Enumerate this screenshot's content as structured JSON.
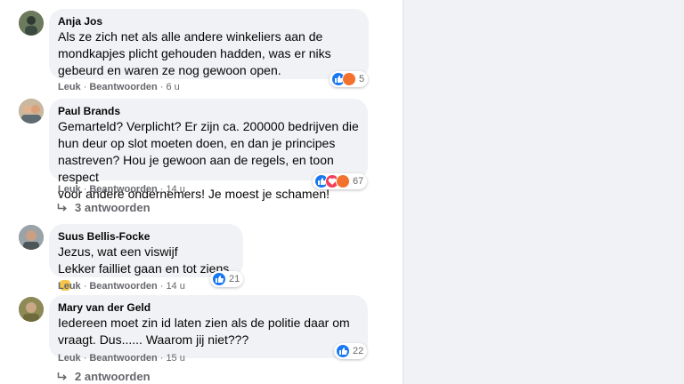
{
  "comments": [
    {
      "author": "Anja Jos",
      "lines": [
        "Als ze zich net als alle andere winkeliers aan de",
        "mondkapjes plicht gehouden hadden, was er niks",
        "gebeurd en waren ze nog gewoon open."
      ],
      "like_label": "Leuk",
      "reply_label": "Beantwoorden",
      "time": "6 u",
      "reaction_count": "5",
      "reactions": [
        "like-icon",
        "angry-icon"
      ]
    },
    {
      "author": "Paul Brands",
      "lines": [
        "Gemarteld? Verplicht? Er zijn ca. 200000 bedrijven die",
        "hun deur op slot moeten doen, en dan je principes",
        "nastreven? Hou je gewoon aan de regels, en toon respect",
        "voor andere ondernemers! Je moest je schamen!"
      ],
      "like_label": "Leuk",
      "reply_label": "Beantwoorden",
      "time": "14 u",
      "reaction_count": "67",
      "reactions": [
        "like-icon",
        "love-icon",
        "angry-icon"
      ],
      "replies_label": "3 antwoorden"
    },
    {
      "author": "Suus Bellis-Focke",
      "lines": [
        "Jezus, wat een viswijf",
        "Lekker failliet gaan en tot ziens"
      ],
      "like_label": "Leuk",
      "reply_label": "Beantwoorden",
      "time": "14 u",
      "reaction_count": "21",
      "reactions": [
        "like-icon"
      ]
    },
    {
      "author": "Mary van der Geld",
      "lines": [
        "Iedereen moet zin id laten zien als de politie daar om",
        "vraagt. Dus...... Waarom jij niet???"
      ],
      "like_label": "Leuk",
      "reply_label": "Beantwoorden",
      "time": "15 u",
      "reaction_count": "22",
      "reactions": [
        "like-icon"
      ],
      "replies_label": "2 antwoorden"
    }
  ],
  "colors": {
    "bubble_bg": "#f0f2f5",
    "meta_text": "#65676b",
    "like_blue": "#1877f2",
    "angry_orange": "#f2712f",
    "love_red": "#f33e58"
  }
}
